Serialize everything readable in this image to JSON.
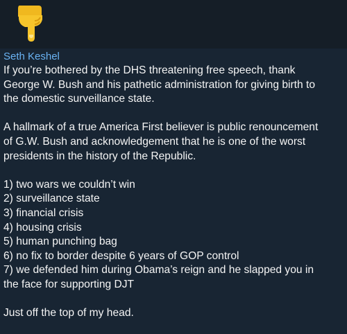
{
  "post": {
    "emoji": "pointing-down-hand",
    "author": "Seth Keshel",
    "paragraphs": [
      "If you’re bothered by the DHS threatening free speech, thank\nGeorge W. Bush and his pathetic administration for giving birth to\nthe domestic surveillance state.",
      "A hallmark of a true America First believer is public renouncement\nof G.W. Bush and acknowledgement that he is one of the worst\npresidents in the history of the Republic.",
      "1) two wars we couldn’t win\n2) surveillance state\n3) financial crisis\n4) housing crisis\n5) human punching bag\n6) no fix to border despite 6 years of GOP control\n7) we defended him during Obama’s reign and he slapped you in\nthe face for supporting DJT",
      "Just off the top of my head."
    ]
  },
  "colors": {
    "background": "#182533",
    "author_name": "#6ab3f3",
    "text": "#f5f5f5",
    "emoji": "#f7c52b"
  }
}
